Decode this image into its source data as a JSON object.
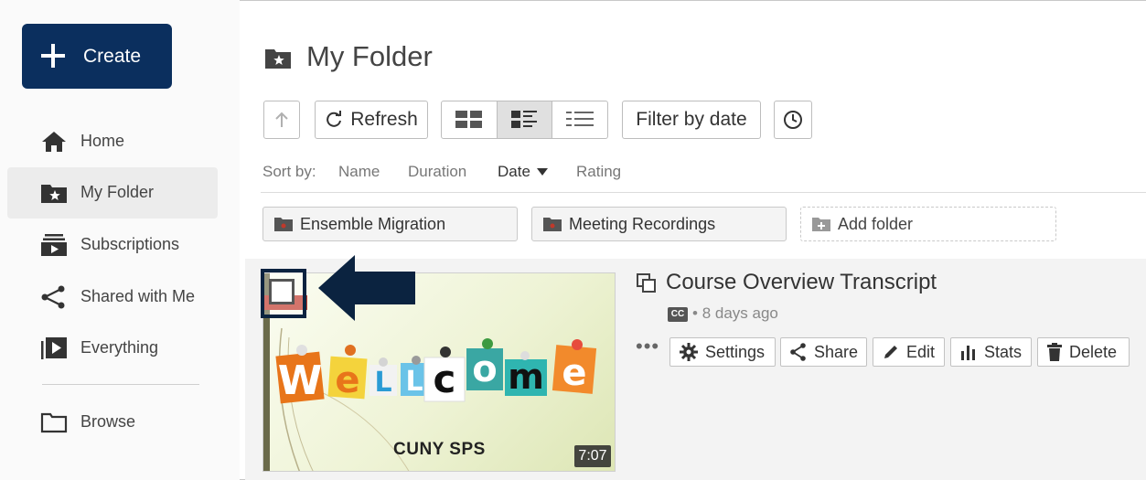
{
  "sidebar": {
    "create_label": "Create",
    "items": [
      {
        "label": "Home",
        "icon": "home-icon"
      },
      {
        "label": "My Folder",
        "icon": "folder-star-icon"
      },
      {
        "label": "Subscriptions",
        "icon": "subscriptions-icon"
      },
      {
        "label": "Shared with Me",
        "icon": "share-icon"
      },
      {
        "label": "Everything",
        "icon": "play-library-icon"
      },
      {
        "label": "Browse",
        "icon": "folder-icon"
      }
    ]
  },
  "header": {
    "title": "My Folder"
  },
  "toolbar": {
    "up_icon": "arrow-up-icon",
    "refresh_label": "Refresh",
    "filter_label": "Filter by date",
    "clock_icon": "clock-icon",
    "views": [
      "grid-view",
      "detail-view",
      "list-view"
    ],
    "selected_view": "detail-view"
  },
  "sort": {
    "prefix": "Sort by:",
    "options": [
      "Name",
      "Duration",
      "Date",
      "Rating"
    ],
    "active": "Date"
  },
  "folders": [
    {
      "label": "Ensemble Migration"
    },
    {
      "label": "Meeting Recordings"
    }
  ],
  "add_folder_label": "Add folder",
  "media": {
    "title": "Course Overview Transcript",
    "meta_sep": "•",
    "age": "8 days ago",
    "duration": "7:07",
    "thumbnail_caption": "CUNY SPS",
    "more_label": "•••",
    "actions": [
      "Settings",
      "Share",
      "Edit",
      "Stats",
      "Delete"
    ]
  },
  "colors": {
    "create_bg": "#0b2f5e",
    "annotation": "#0b2340",
    "active_nav_bg": "#ececec"
  }
}
